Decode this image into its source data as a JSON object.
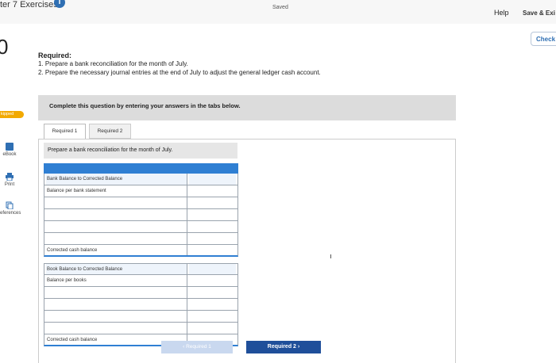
{
  "header": {
    "title": "ter 7 Exercises",
    "info_icon": "i",
    "saved_label": "Saved",
    "help_label": "Help",
    "save_exit_label": "Save & Exi",
    "check_label": "Check"
  },
  "question": {
    "number": "0",
    "skipped_label": "kipped",
    "required_heading": "Required:",
    "requirements": [
      "1. Prepare a bank reconciliation for the month of July.",
      "2. Prepare the necessary journal entries at the end of July to adjust the general ledger cash account."
    ],
    "instruction": "Complete this question by entering your answers in the tabs below."
  },
  "sidebar": {
    "items": [
      {
        "label": "eBook",
        "icon": "book-icon"
      },
      {
        "label": "Print",
        "icon": "printer-icon"
      },
      {
        "label": "eferences",
        "icon": "references-icon"
      }
    ]
  },
  "tabs": [
    {
      "label": "Required 1",
      "active": true
    },
    {
      "label": "Required 2",
      "active": false
    }
  ],
  "prompt": "Prepare a bank reconciliation for the month of July.",
  "reconciliation": {
    "bank_rows": [
      {
        "label": "Bank Balance to Corrected Balance",
        "value": ""
      },
      {
        "label": "Balance per bank statement",
        "value": ""
      },
      {
        "label": "",
        "value": ""
      },
      {
        "label": "",
        "value": ""
      },
      {
        "label": "",
        "value": ""
      },
      {
        "label": "",
        "value": ""
      }
    ],
    "bank_total": "Corrected cash balance",
    "book_rows": [
      {
        "label": "Book Balance to Corrected Balance",
        "value": ""
      },
      {
        "label": "Balance per books",
        "value": ""
      },
      {
        "label": "",
        "value": ""
      },
      {
        "label": "",
        "value": ""
      },
      {
        "label": "",
        "value": ""
      },
      {
        "label": "",
        "value": ""
      }
    ],
    "book_total": "Corrected cash balance"
  },
  "navigation": {
    "prev_label": "‹  Required 1",
    "next_label": "Required 2  ›"
  }
}
